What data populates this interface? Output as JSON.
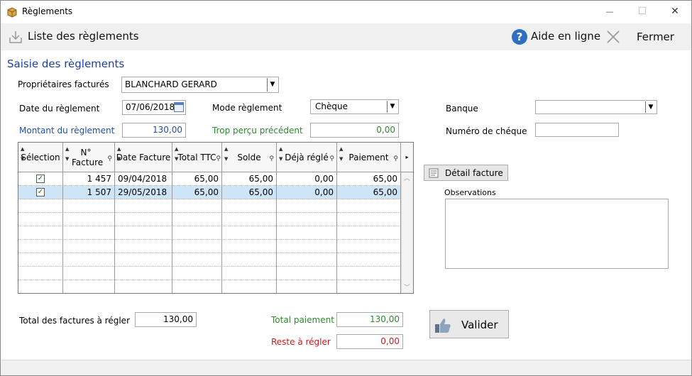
{
  "window": {
    "title": "Règlements",
    "minimize_glyph": "—",
    "maximize_glyph": "☐",
    "close_glyph": "✕"
  },
  "toolbar": {
    "list_label": "Liste des règlements",
    "help_label": "Aide en ligne",
    "close_label": "Fermer"
  },
  "section_title": "Saisie des règlements",
  "form": {
    "owners_label": "Propriétaires facturés",
    "owners_value": "BLANCHARD GERARD",
    "date_label": "Date du règlement",
    "date_value": "07/06/2018",
    "mode_label": "Mode règlement",
    "mode_value": "Chèque",
    "bank_label": "Banque",
    "bank_value": "",
    "amount_label": "Montant du règlement",
    "amount_value": "130,00",
    "overpaid_label": "Trop perçu précédent",
    "overpaid_value": "0,00",
    "cheque_label": "Numéro de chéque",
    "cheque_value": ""
  },
  "grid": {
    "headers": [
      "Sélection",
      "N° Facture",
      "Date Facture",
      "Total TTC",
      "Solde",
      "Déjà réglé",
      "Paiement"
    ],
    "rows": [
      {
        "selected": true,
        "checked": "✓",
        "num": "1 457",
        "date": "09/04/2018",
        "total": "65,00",
        "solde": "65,00",
        "deja": "0,00",
        "paiement": "65,00"
      },
      {
        "selected": true,
        "checked": "✓",
        "num": "1 507",
        "date": "29/05/2018",
        "total": "65,00",
        "solde": "65,00",
        "deja": "0,00",
        "paiement": "65,00"
      }
    ]
  },
  "detail_button": "Détail facture",
  "observations_label": "Observations",
  "totals": {
    "total_invoices_label": "Total des factures à régler",
    "total_invoices_value": "130,00",
    "total_payment_label": "Total paiement",
    "total_payment_value": "130,00",
    "remaining_label": "Reste à régler",
    "remaining_value": "0,00"
  },
  "validate_button": "Valider",
  "colors": {
    "section_title": "#1f3f9f",
    "amount": "#1f4fa8",
    "positive": "#2d8a2d",
    "remaining": "#d0161b",
    "selected_row": "#cde5f7"
  }
}
